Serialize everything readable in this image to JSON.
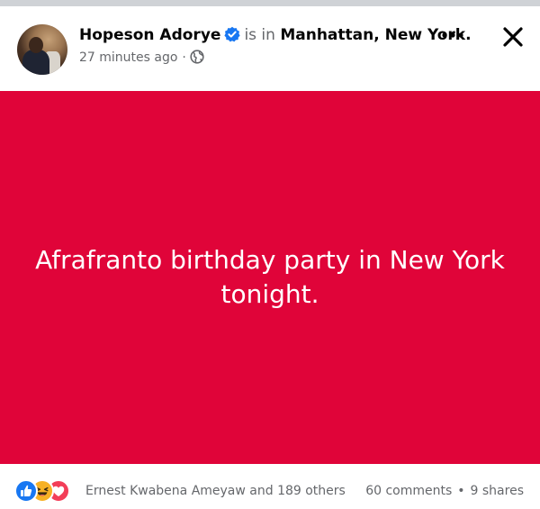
{
  "post": {
    "author": {
      "name": "Hopeson Adorye",
      "verified_icon": "verified-badge-icon",
      "is_in_text": "is in",
      "location": "Manhattan, New York."
    },
    "meta": {
      "time": "27 minutes ago",
      "separator": "·",
      "privacy_icon": "globe-icon"
    },
    "menu_icon": "more-options-icon",
    "close_icon": "close-icon",
    "body": {
      "text": "Afrafranto birthday party in New York tonight.",
      "background_color": "#e00439",
      "text_color": "#ffffff"
    },
    "footer": {
      "reaction_icons": [
        "like-icon",
        "haha-icon",
        "love-icon"
      ],
      "reaction_summary": "Ernest Kwabena Ameyaw and 189 others",
      "comments": "60 comments",
      "separator": "•",
      "shares": "9 shares"
    }
  },
  "colors": {
    "accent_blue": "#1877f2",
    "secondary_text": "#65676b",
    "top_bar": "#cfd2d6"
  }
}
